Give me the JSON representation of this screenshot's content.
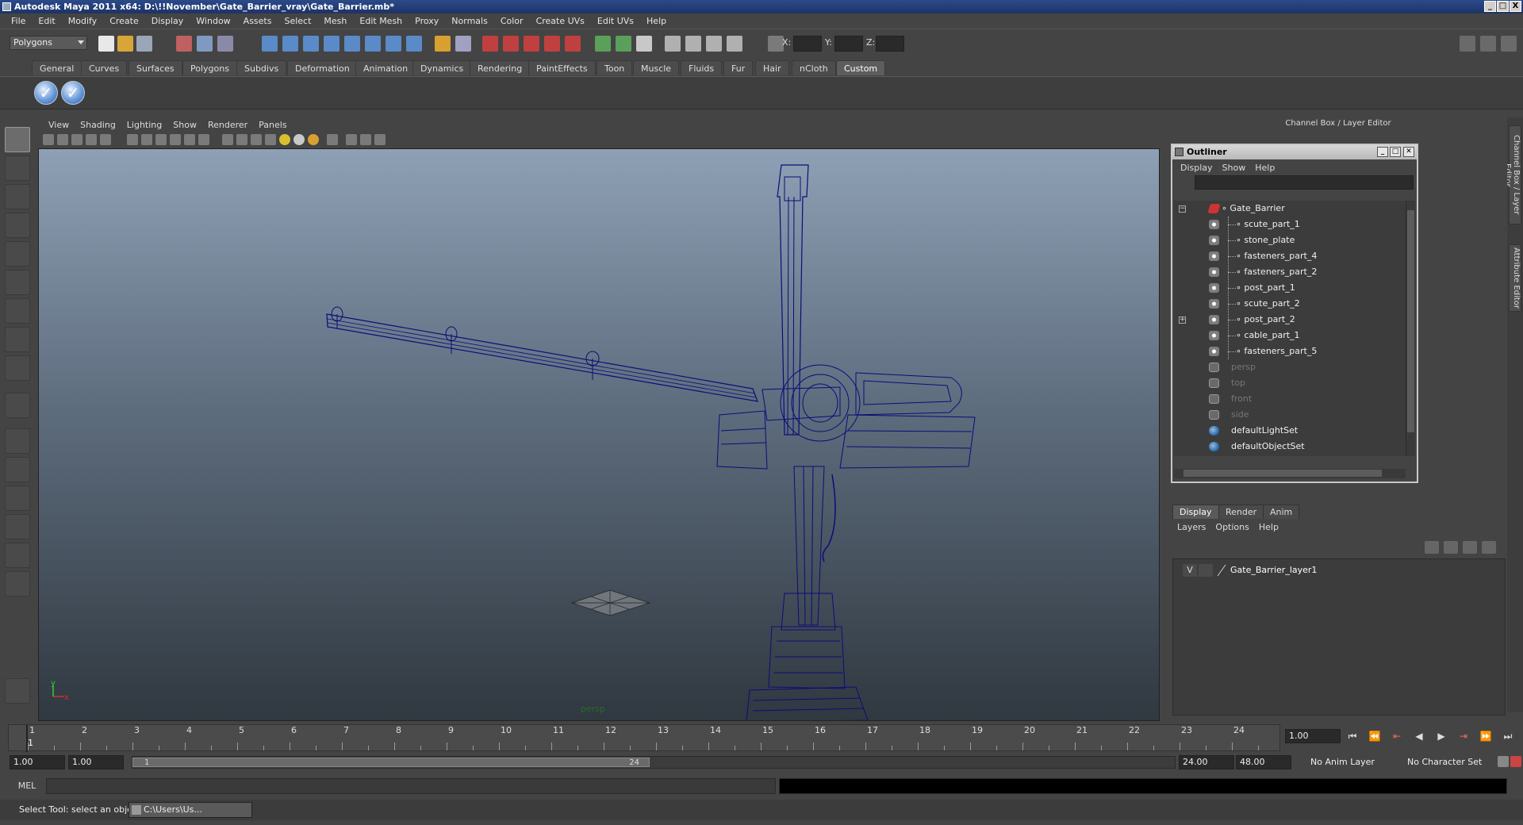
{
  "window": {
    "title": "Autodesk Maya 2011 x64: D:\\!!November\\Gate_Barrier_vray\\Gate_Barrier.mb*",
    "buttons": [
      "_",
      "□",
      "X"
    ]
  },
  "menubar": [
    "File",
    "Edit",
    "Modify",
    "Create",
    "Display",
    "Window",
    "Assets",
    "Select",
    "Mesh",
    "Edit Mesh",
    "Proxy",
    "Normals",
    "Color",
    "Create UVs",
    "Edit UVs",
    "Help"
  ],
  "statusline": {
    "mode": "Polygons",
    "coord_labels": [
      "X:",
      "Y:",
      "Z:"
    ]
  },
  "shelf": {
    "tabs": [
      "General",
      "Curves",
      "Surfaces",
      "Polygons",
      "Subdivs",
      "Deformation",
      "Animation",
      "Dynamics",
      "Rendering",
      "PaintEffects",
      "Toon",
      "Muscle",
      "Fluids",
      "Fur",
      "Hair",
      "nCloth",
      "Custom"
    ],
    "active_tab": "Custom",
    "buttons": [
      "check-icon",
      "check-icon"
    ]
  },
  "viewport": {
    "menu": [
      "View",
      "Shading",
      "Lighting",
      "Show",
      "Renderer",
      "Panels"
    ],
    "camera": "persp",
    "axis_labels": {
      "x": "x",
      "y": "y"
    },
    "wireframe_color": "#0c0c78"
  },
  "right_panel": {
    "header": "Channel Box / Layer Editor",
    "side_tabs": [
      "Channel Box / Layer Editor",
      "Attribute Editor"
    ]
  },
  "outliner": {
    "title": "Outliner",
    "menu": [
      "Display",
      "Show",
      "Help"
    ],
    "root": "Gate_Barrier",
    "children": [
      "scute_part_1",
      "stone_plate",
      "fasteners_part_4",
      "fasteners_part_2",
      "post_part_1",
      "scute_part_2",
      "post_part_2",
      "cable_part_1",
      "fasteners_part_5"
    ],
    "cameras": [
      "persp",
      "top",
      "front",
      "side"
    ],
    "sets": [
      "defaultLightSet",
      "defaultObjectSet"
    ]
  },
  "layer_editor": {
    "tabs": [
      "Display",
      "Render",
      "Anim"
    ],
    "active_tab": "Display",
    "menu": [
      "Layers",
      "Options",
      "Help"
    ],
    "layers": [
      {
        "visible": "V",
        "name": "Gate_Barrier_layer1"
      }
    ]
  },
  "timeline": {
    "ticks": [
      "1",
      "2",
      "3",
      "4",
      "5",
      "6",
      "7",
      "8",
      "9",
      "10",
      "11",
      "12",
      "13",
      "14",
      "15",
      "16",
      "17",
      "18",
      "19",
      "20",
      "21",
      "22",
      "23",
      "24"
    ],
    "current_frame_label": "1",
    "current_frame": "1.00"
  },
  "range": {
    "start_time": "1.00",
    "playback_start": "1.00",
    "thumb_start": "1",
    "thumb_end": "24",
    "playback_end": "24.00",
    "end_time": "48.00",
    "anim_layer": "No Anim Layer",
    "character_set": "No Character Set"
  },
  "command_line": {
    "label": "MEL"
  },
  "helpline": {
    "text": "Select Tool: select an object",
    "taskbar_item": "C:\\Users\\Us..."
  }
}
